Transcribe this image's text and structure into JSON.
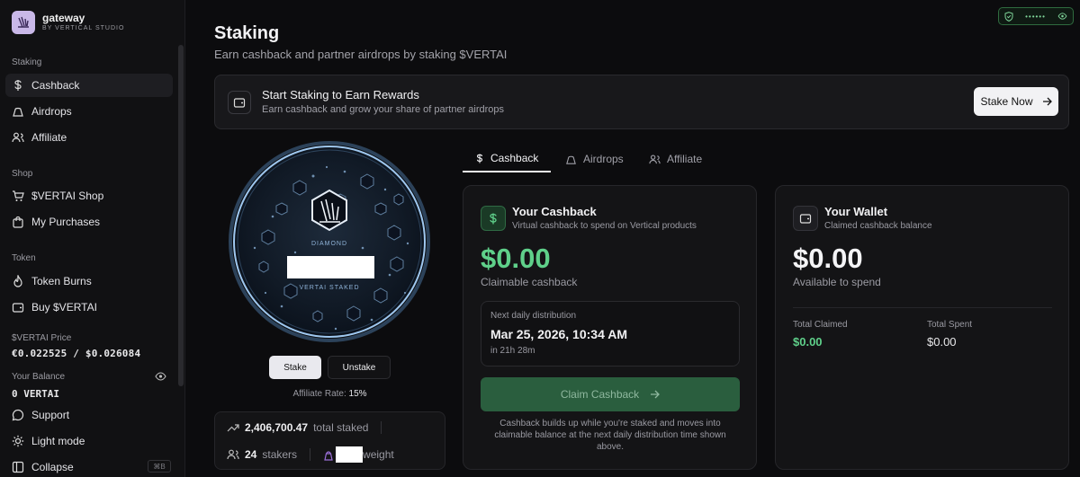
{
  "brand": {
    "name": "gateway",
    "sub": "BY VERTICAL STUDIO"
  },
  "sidebar": {
    "sections": {
      "staking": "Staking",
      "shop": "Shop",
      "token": "Token"
    },
    "items": {
      "cashback": "Cashback",
      "airdrops": "Airdrops",
      "affiliate": "Affiliate",
      "shop": "$VERTAI Shop",
      "purchases": "My Purchases",
      "burns": "Token Burns",
      "buy": "Buy $VERTAI"
    },
    "price_label": "$VERTAI Price",
    "price_value": "€0.022525 / $0.026084",
    "balance_label": "Your Balance",
    "balance_value": "0 VERTAI",
    "support": "Support",
    "light_mode": "Light mode",
    "collapse": "Collapse",
    "collapse_shortcut": "⌘B"
  },
  "header": {
    "title": "Staking",
    "subtitle": "Earn cashback and partner airdrops by staking $VERTAI",
    "status_dots": "••••••"
  },
  "banner": {
    "title": "Start Staking to Earn Rewards",
    "subtitle": "Earn cashback and grow your share of partner airdrops",
    "button": "Stake Now"
  },
  "orb": {
    "tier": "DIAMOND",
    "staked_label": "VERTAI STAKED"
  },
  "actions": {
    "stake": "Stake",
    "unstake": "Unstake",
    "affiliate_rate_label": "Affiliate Rate:",
    "affiliate_rate_value": "15%"
  },
  "stats": {
    "total_staked_value": "2,406,700.47",
    "total_staked_label": "total staked",
    "stakers_value": "24",
    "stakers_label": "stakers",
    "weight_label": "weight"
  },
  "tabs": [
    "Cashback",
    "Airdrops",
    "Affiliate"
  ],
  "cashback_card": {
    "title": "Your Cashback",
    "subtitle": "Virtual cashback to spend on Vertical products",
    "amount": "$0.00",
    "amount_label": "Claimable cashback",
    "next_label": "Next daily distribution",
    "next_date": "Mar 25, 2026, 10:34 AM",
    "next_in": "in 21h 28m",
    "claim_button": "Claim Cashback",
    "note": "Cashback builds up while you're staked and moves into claimable balance at the next daily distribution time shown above."
  },
  "wallet_card": {
    "title": "Your Wallet",
    "subtitle": "Claimed cashback balance",
    "amount": "$0.00",
    "amount_label": "Available to spend",
    "total_claimed_label": "Total Claimed",
    "total_claimed_value": "$0.00",
    "total_spent_label": "Total Spent",
    "total_spent_value": "$0.00"
  },
  "colors": {
    "accent_green": "#5fd08a",
    "claim_button_bg": "#2a5e3e",
    "orb_glow": "#6aa8e8"
  }
}
